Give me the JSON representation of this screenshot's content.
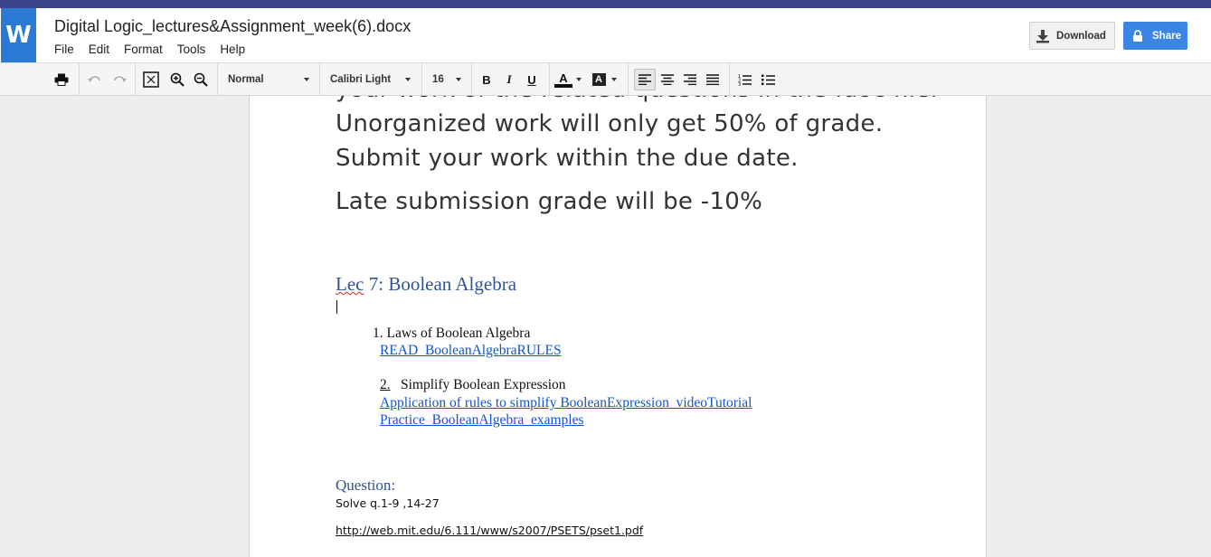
{
  "app": {
    "logo_letter": "W",
    "doc_title": "Digital Logic_lectures&Assignment_week(6).docx",
    "menu": [
      "File",
      "Edit",
      "Format",
      "Tools",
      "Help"
    ],
    "download_label": "Download",
    "share_label": "Share"
  },
  "toolbar": {
    "style_value": "Normal",
    "font_value": "Calibri Light",
    "size_value": "16",
    "bold": "B",
    "italic": "I",
    "underline": "U",
    "text_color_letter": "A",
    "highlight_letter": "A"
  },
  "document": {
    "lines": [
      "your work of the related questions in the .doc file.",
      "Unorganized work will only get 50% of grade.",
      "Submit your work within the due date.",
      "Late submission grade will be -10%"
    ],
    "heading_lec": "Lec",
    "heading_rest": " 7:  Boolean Algebra",
    "item1": "1.  Laws of Boolean Algebra",
    "item1_link": "READ_BooleanAlgebraRULES",
    "item2_num": "2.",
    "item2_text": "Simplify Boolean Expression",
    "item2_link1": "Application of rules to simplify BooleanExpression_videoTutorial",
    "item2_link2": "Practice_BooleanAlgebra_examples ",
    "question_heading": "Question:",
    "question_text": "Solve q.1-9 ,14-27",
    "question_link": "http://web.mit.edu/6.111/www/s2007/PSETS/pset1.pdf"
  },
  "colors": {
    "accent_blue": "#3a85e6",
    "logo_blue": "#2a7ad5",
    "top_stripe": "#3b4589",
    "heading_blue": "#2f5496",
    "link_blue": "#1155cc"
  },
  "icons": [
    "print-icon",
    "undo-icon",
    "redo-icon",
    "fit-page-icon",
    "zoom-in-icon",
    "zoom-out-icon",
    "align-left-icon",
    "align-center-icon",
    "align-right-icon",
    "align-justify-icon",
    "numbered-list-icon",
    "bulleted-list-icon",
    "download-icon",
    "lock-icon"
  ]
}
